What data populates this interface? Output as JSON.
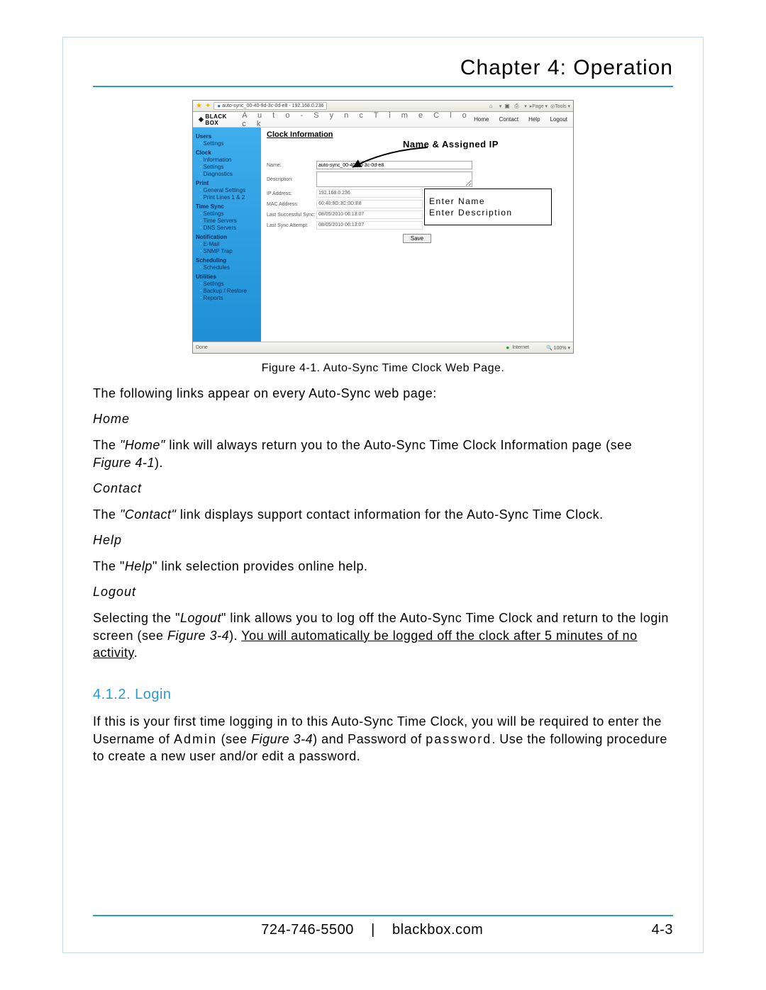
{
  "chapter_title": "Chapter 4: Operation",
  "figure": {
    "caption": "Figure 4-1.  Auto-Sync Time Clock Web Page.",
    "browser_tab": "auto-sync_00-40-9d-3c-0d-e8 - 192.168.0.236",
    "toolbar_page": "Page",
    "toolbar_tools": "Tools",
    "logo_text": "BLACK BOX",
    "app_title": "A u t o - S y n c   T i m e   C l o c k",
    "topnav": {
      "home": "Home",
      "contact": "Contact",
      "help": "Help",
      "logout": "Logout"
    },
    "sidebar": {
      "users": "Users",
      "users_items": [
        "Settings"
      ],
      "clock": "Clock",
      "clock_items": [
        "Information",
        "Settings",
        "Diagnostics"
      ],
      "print": "Print",
      "print_items": [
        "General Settings",
        "Print Lines 1 & 2"
      ],
      "timesync": "Time Sync",
      "timesync_items": [
        "Settings",
        "Time Servers",
        "DNS Servers"
      ],
      "notification": "Notification",
      "notification_items": [
        "E-Mail",
        "SNMP Trap"
      ],
      "scheduling": "Scheduling",
      "scheduling_items": [
        "Schedules"
      ],
      "utilities": "Utilities",
      "utilities_items": [
        "Settings",
        "Backup / Restore",
        "Reports"
      ]
    },
    "main": {
      "section": "Clock Information",
      "labels": {
        "name": "Name:",
        "description": "Description:",
        "ip": "IP Address:",
        "mac": "MAC Address:",
        "last_success": "Last Successful Sync:",
        "last_attempt": "Last Sync Attempt:"
      },
      "values": {
        "name": "auto-sync_00-40-9d-3c-0d-e8",
        "description": "",
        "ip": "192.168.0.236",
        "mac": "60:40:9D:3C:0D:E8",
        "last_success": "08/05/2010 06:13:07",
        "last_attempt": "08/05/2010 06:13:07"
      },
      "save_btn": "Save"
    },
    "callout_title": "Name & Assigned IP",
    "callout_box": {
      "line1": "Enter Name",
      "line2": "Enter Description"
    },
    "status": {
      "left": "Done",
      "right": "Internet",
      "zoom": "100%"
    }
  },
  "intro_text": "The following links appear on every Auto-Sync web page:",
  "sections": {
    "home": {
      "head": "Home",
      "p1a": "The ",
      "p1b": "\"Home\"",
      "p1c": " link will always return you to the Auto-Sync Time Clock Information page (see ",
      "p1d": "Figure 4-1",
      "p1e": ")."
    },
    "contact": {
      "head": "Contact",
      "p1a": "The ",
      "p1b": "\"Contact\"",
      "p1c": " link displays support contact information for the Auto-Sync Time Clock."
    },
    "help": {
      "head": "Help",
      "p1a": "The \"",
      "p1b": "Help",
      "p1c": "\" link selection provides online help."
    },
    "logout": {
      "head": "Logout",
      "p1a": "Selecting the \"",
      "p1b": "Logout",
      "p1c": "\" link allows you to log off the Auto-Sync Time Clock and return to the login screen (see ",
      "p1d": "Figure 3-4",
      "p1e": "). ",
      "p1f": "You will automatically be logged off the clock after 5 minutes of no activity",
      "p1g": "."
    }
  },
  "login_section": {
    "num": "4.1.2.  Login",
    "p1a": "If this is your first time logging in to this Auto-Sync Time Clock, you will be required to enter the Username of ",
    "p1b": "Admin",
    "p1c": " (see ",
    "p1d": "Figure 3-4",
    "p1e": ") and Password of ",
    "p1f": "password",
    "p1g": ". Use the following procedure to create a new user and/or edit a password."
  },
  "footer": {
    "phone": "724-746-5500",
    "sep": "|",
    "site": "blackbox.com",
    "page": "4-3"
  }
}
